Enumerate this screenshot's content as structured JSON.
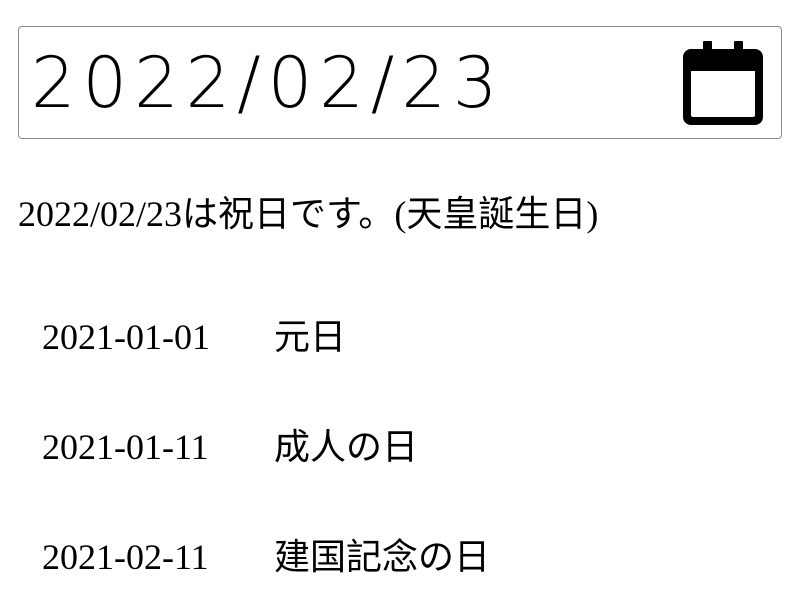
{
  "date_input": {
    "value": "2022/02/23",
    "calendar_icon": "calendar-icon"
  },
  "result_text": "2022/02/23は祝日です。(天皇誕生日)",
  "holidays": [
    {
      "date": "2021-01-01",
      "name": "元日"
    },
    {
      "date": "2021-01-11",
      "name": "成人の日"
    },
    {
      "date": "2021-02-11",
      "name": "建国記念の日"
    }
  ]
}
